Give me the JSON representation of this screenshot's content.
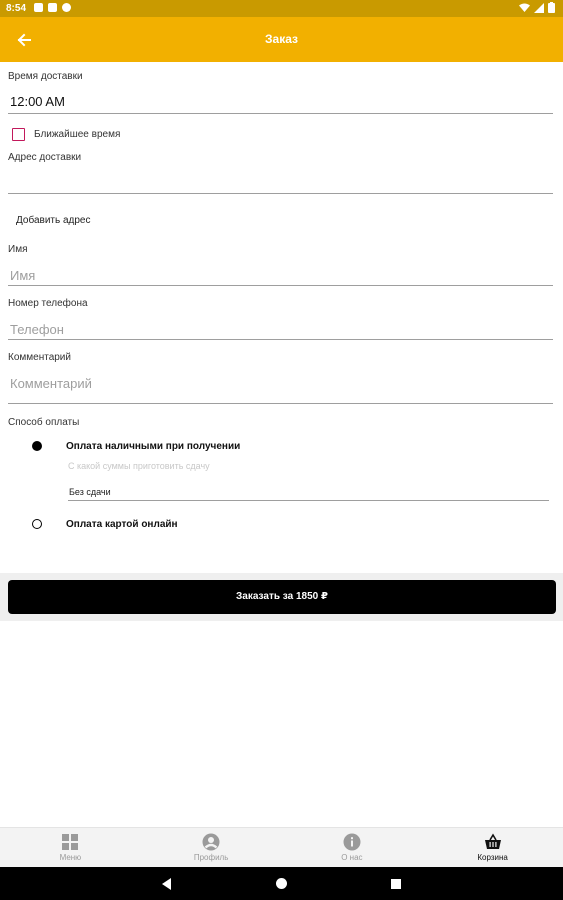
{
  "status_bar": {
    "time": "8:54"
  },
  "app_bar": {
    "title": "Заказ",
    "back_icon": "arrow-left-icon"
  },
  "form": {
    "delivery_time_label": "Время доставки",
    "delivery_time_value": "12:00 AM",
    "nearest_time_label": "Ближайшее время",
    "nearest_time_checked": false,
    "address_label": "Адрес доставки",
    "address_value": "",
    "add_address": "Добавить адрес",
    "name_label": "Имя",
    "name_placeholder": "Имя",
    "phone_label": "Номер телефона",
    "phone_placeholder": "Телефон",
    "comment_label": "Комментарий",
    "comment_placeholder": "Комментарий",
    "payment_label": "Способ оплаты",
    "payment_options": [
      {
        "label": "Оплата наличными при получении",
        "selected": true
      },
      {
        "label": "Оплата картой онлайн",
        "selected": false
      }
    ],
    "change_hint": "С какой суммы приготовить сдачу",
    "change_value": "Без сдачи"
  },
  "order_button": {
    "label": "Заказать за 1850 ₽"
  },
  "bottom_nav": [
    {
      "label": "Меню",
      "icon": "grid-icon",
      "active": false
    },
    {
      "label": "Профиль",
      "icon": "profile-icon",
      "active": false
    },
    {
      "label": "О нас",
      "icon": "info-icon",
      "active": false
    },
    {
      "label": "Корзина",
      "icon": "basket-icon",
      "active": true
    }
  ],
  "colors": {
    "app_bar": "#f2b000",
    "status_bar": "#c99a00",
    "checkbox_border": "#c2185b",
    "button": "#000000"
  }
}
